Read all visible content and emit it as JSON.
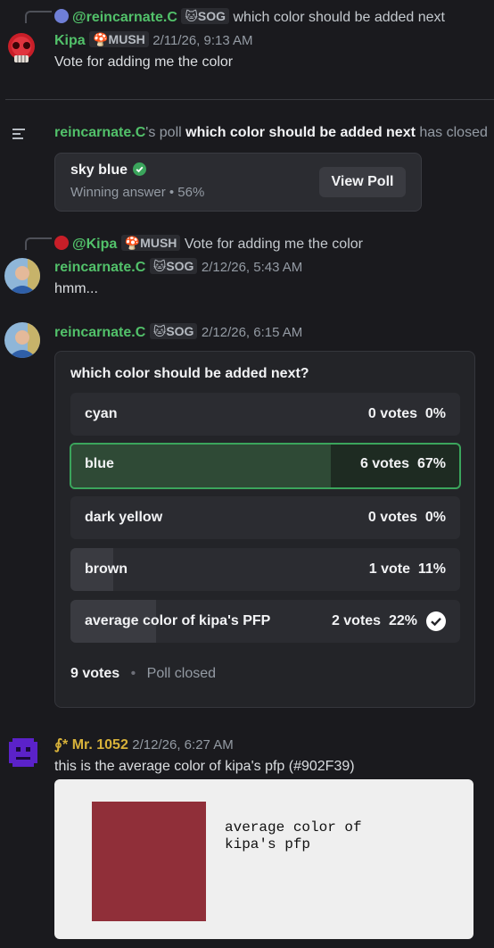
{
  "colors": {
    "accent_green": "#3ba55c",
    "username_green": "#52c16a",
    "swatch": "#902F39"
  },
  "msg1": {
    "reply_user": "@reincarnate.C",
    "reply_tag": "🐱SOG",
    "reply_text": "which color should be added next",
    "author": "Kipa",
    "tag": "🍄MUSH",
    "time": "2/11/26, 9:13 AM",
    "text": "Vote for adding me the color"
  },
  "system": {
    "user": "reincarnate.C",
    "poss": "'s poll ",
    "poll_name": "which color should be added next",
    "suffix": " has closed",
    "result_answer": "sky blue",
    "result_sub": "Winning answer • 56%",
    "view_button": "View Poll"
  },
  "msg2": {
    "reply_user": "@Kipa",
    "reply_tag": "🍄MUSH",
    "reply_text": "Vote for adding me the color",
    "author": "reincarnate.C",
    "tag": "🐱SOG",
    "time": "2/12/26, 5:43 AM",
    "text": "hmm..."
  },
  "msg3": {
    "author": "reincarnate.C",
    "tag": "🐱SOG",
    "time": "2/12/26, 6:15 AM"
  },
  "poll": {
    "question": "which color should be added next?",
    "options": [
      {
        "label": "cyan",
        "votes": "0 votes",
        "pct": "0%",
        "share": 0
      },
      {
        "label": "blue",
        "votes": "6 votes",
        "pct": "67%",
        "share": 0.67
      },
      {
        "label": "dark yellow",
        "votes": "0 votes",
        "pct": "0%",
        "share": 0
      },
      {
        "label": "brown",
        "votes": "1 vote",
        "pct": "11%",
        "share": 0.11
      },
      {
        "label": "average color of kipa's PFP",
        "votes": "2 votes",
        "pct": "22%",
        "share": 0.22
      }
    ],
    "total": "9 votes",
    "dot": "•",
    "status": "Poll closed"
  },
  "msg4": {
    "author_prefix": "∮*",
    "author": "Mr. 1052",
    "time": "2/12/26, 6:27 AM",
    "text": "this is the average color of kipa's pfp (#902F39)",
    "embed_caption_1": "average color of",
    "embed_caption_2": "kipa's pfp"
  }
}
